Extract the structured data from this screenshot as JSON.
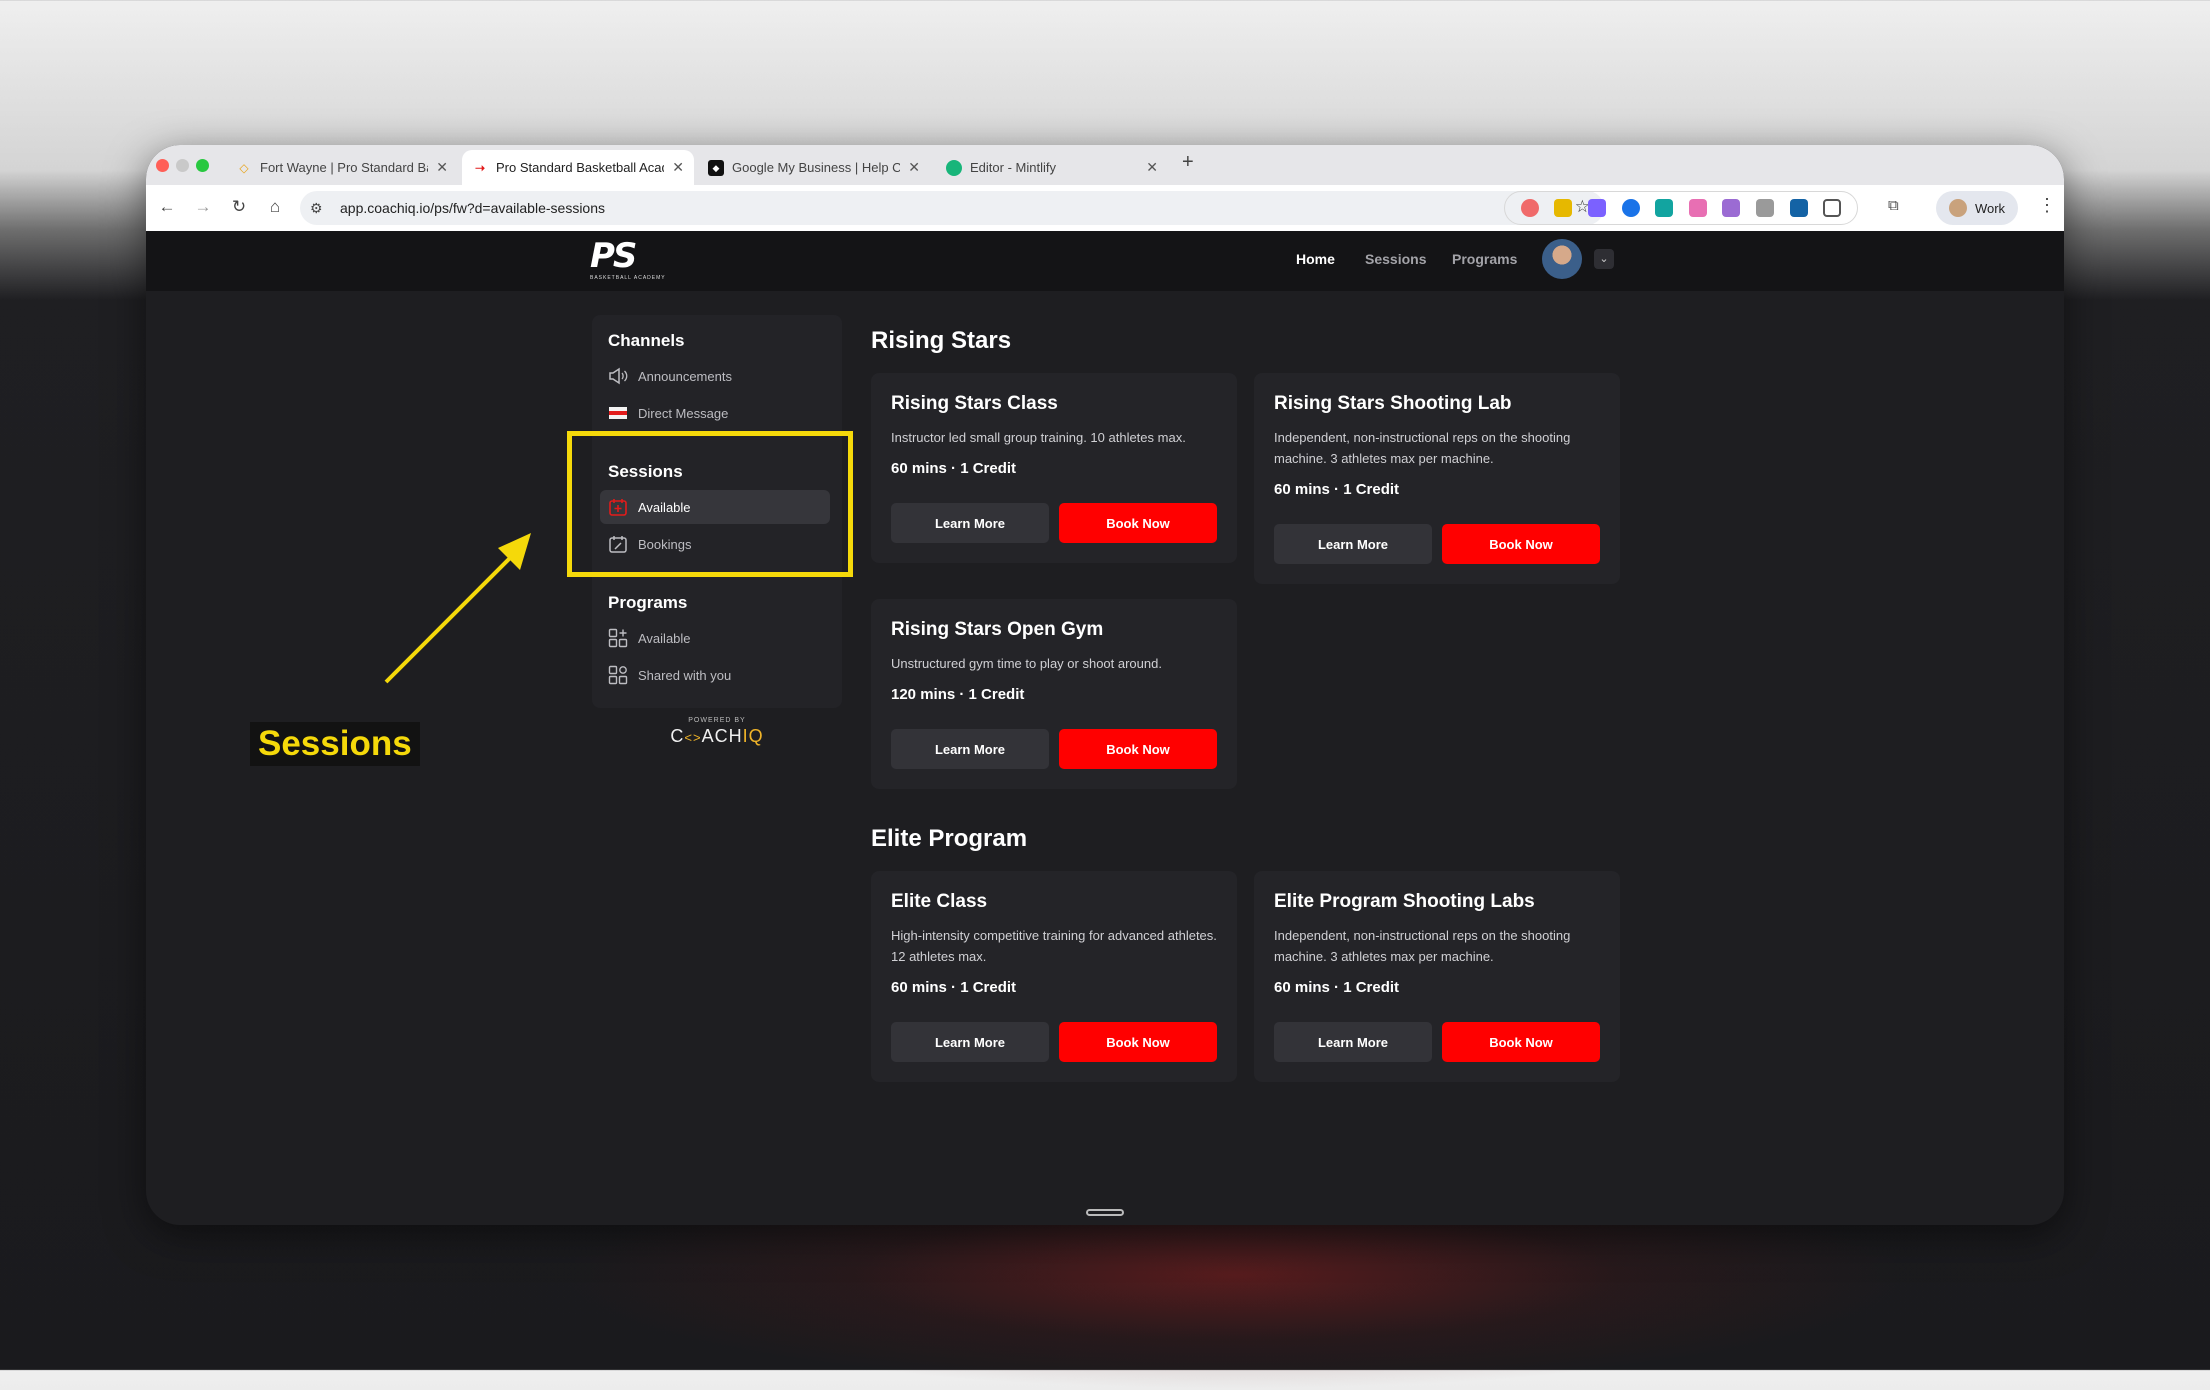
{
  "browser": {
    "tabs": [
      {
        "title": "Fort Wayne | Pro Standard Ba",
        "favicon": "diamond-favicon"
      },
      {
        "title": "Pro Standard Basketball Acad",
        "favicon": "ps-favicon",
        "active": true
      },
      {
        "title": "Google My Business | Help Ce",
        "favicon": "gmb-favicon"
      },
      {
        "title": "Editor - Mintlify",
        "favicon": "mintlify-favicon"
      }
    ],
    "url": "app.coachiq.io/ps/fw?d=available-sessions",
    "profile_label": "Work"
  },
  "header": {
    "logo_text": "PS",
    "logo_subtext": "BASKETBALL ACADEMY",
    "nav": [
      {
        "label": "Home",
        "active": true
      },
      {
        "label": "Sessions"
      },
      {
        "label": "Programs"
      }
    ]
  },
  "sidebar": {
    "channels": {
      "heading": "Channels",
      "items": [
        {
          "label": "Announcements",
          "icon": "megaphone-icon"
        },
        {
          "label": "Direct Message",
          "icon": "direct-message-icon"
        }
      ]
    },
    "sessions": {
      "heading": "Sessions",
      "items": [
        {
          "label": "Available",
          "icon": "calendar-plus-icon",
          "active": true
        },
        {
          "label": "Bookings",
          "icon": "calendar-edit-icon"
        }
      ]
    },
    "programs": {
      "heading": "Programs",
      "items": [
        {
          "label": "Available",
          "icon": "grid-plus-icon"
        },
        {
          "label": "Shared with you",
          "icon": "grid-share-icon"
        }
      ]
    },
    "powered_by": "POWERED BY",
    "brand_left": "C",
    "brand_arrows": "<>",
    "brand_mid": "ACH",
    "brand_right": "IQ"
  },
  "sections": [
    {
      "title": "Rising Stars",
      "cards": [
        {
          "title": "Rising Stars Class",
          "description": "Instructor led small group training. 10 athletes max.",
          "meta": "60 mins · 1 Credit",
          "learn": "Learn More",
          "book": "Book Now"
        },
        {
          "title": "Rising Stars Shooting Lab",
          "description": "Independent, non-instructional reps on the shooting machine. 3 athletes max per machine.",
          "meta": "60 mins · 1 Credit",
          "learn": "Learn More",
          "book": "Book Now"
        },
        {
          "title": "Rising Stars Open Gym",
          "description": "Unstructured gym time to play or shoot around.",
          "meta": "120 mins · 1 Credit",
          "learn": "Learn More",
          "book": "Book Now"
        }
      ]
    },
    {
      "title": "Elite Program",
      "cards": [
        {
          "title": "Elite Class",
          "description": "High-intensity competitive training for advanced athletes. 12 athletes max.",
          "meta": "60 mins · 1 Credit",
          "learn": "Learn More",
          "book": "Book Now"
        },
        {
          "title": "Elite Program Shooting Labs",
          "description": "Independent, non-instructional reps on the shooting machine. 3 athletes max per machine.",
          "meta": "60 mins · 1 Credit",
          "learn": "Learn More",
          "book": "Book Now"
        }
      ]
    }
  ],
  "annotation": {
    "label": "Sessions",
    "color": "#f5d90a"
  },
  "colors": {
    "accent": "#ff0000",
    "background": "#1e1e21",
    "card": "#242428"
  }
}
